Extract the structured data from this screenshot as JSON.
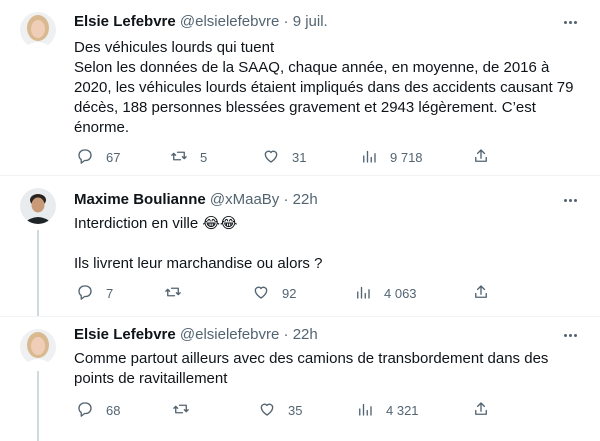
{
  "colors": {
    "text": "#0f1419",
    "secondary": "#536471",
    "divider": "#eff3f4",
    "thread_line": "#cfd9de"
  },
  "tweets": [
    {
      "author_name": "Elsie Lefebvre",
      "handle": "@elsielefebvre",
      "separator": "·",
      "time": "9 juil.",
      "text": "Des véhicules lourds qui tuent\nSelon les données de la SAAQ, chaque année, en moyenne, de 2016 à 2020, les véhicules lourds étaient impliqués dans des accidents causant 79 décès, 188 personnes blessées gravement et 2943 légèrement. C’est énorme.",
      "replies": "67",
      "retweets": "5",
      "likes": "31",
      "views": "9 718"
    },
    {
      "author_name": "Maxime Boulianne",
      "handle": "@xMaaBy",
      "separator": "·",
      "time": "22h",
      "text": "Interdiction en ville 😂😂\n\nIls livrent leur marchandise ou alors ?",
      "replies": "7",
      "retweets": "",
      "likes": "92",
      "views": "4 063"
    },
    {
      "author_name": "Elsie Lefebvre",
      "handle": "@elsielefebvre",
      "separator": "·",
      "time": "22h",
      "text": "Comme partout ailleurs avec des camions de transbordement dans des points de ravitaillement",
      "replies": "68",
      "retweets": "",
      "likes": "35",
      "views": "4 321"
    }
  ],
  "icons": {
    "reply": "reply-icon",
    "retweet": "retweet-icon",
    "like": "heart-icon",
    "views": "analytics-icon",
    "share": "share-icon",
    "more": "more-icon"
  }
}
